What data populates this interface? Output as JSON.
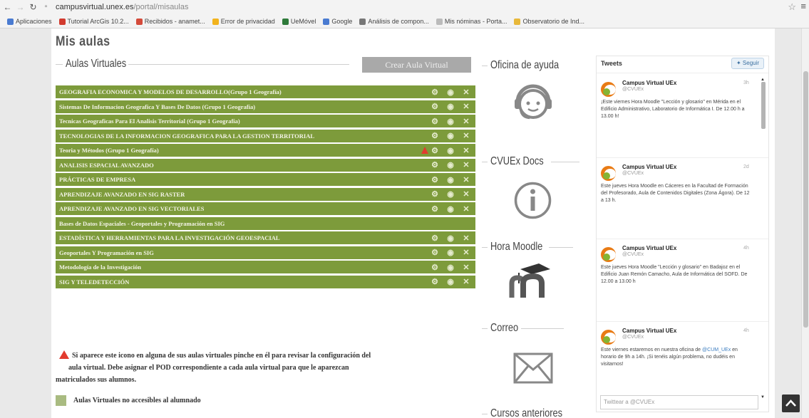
{
  "browser": {
    "url_host": "campusvirtual.unex.es",
    "url_path": "/portal/misaulas",
    "bookmarks": [
      {
        "label": "Aplicaciones",
        "color": "#4a7bd1"
      },
      {
        "label": "Tutorial ArcGis 10.2...",
        "color": "#d23b2f"
      },
      {
        "label": "Recibidos - anamet...",
        "color": "#d44a3a"
      },
      {
        "label": "Error de privacidad",
        "color": "#f2b31d"
      },
      {
        "label": "UeMóvel",
        "color": "#2e7a3a"
      },
      {
        "label": "Google",
        "color": "#4a7bd1"
      },
      {
        "label": "Análisis de compon...",
        "color": "#777777"
      },
      {
        "label": "Mis nóminas - Porta...",
        "color": "#bbbbbb"
      },
      {
        "label": "Observatorio de Ind...",
        "color": "#e8b83a"
      }
    ]
  },
  "main": {
    "heading": "Mis aulas",
    "aulas_title": "Aulas Virtuales",
    "crear_label": "Crear Aula Virtual",
    "courses": [
      {
        "name": "GEOGRAFIA ECONOMICA Y MODELOS DE DESARROLLO(Grupo 1 Geografía)",
        "actions": true,
        "warning": false
      },
      {
        "name": "Sistemas De Informacion Geografica Y Bases De Datos (Grupo 1 Geografía)",
        "actions": true,
        "warning": false
      },
      {
        "name": "Tecnicas Geograficas Para El Analisis Territorial (Grupo 1 Geografía)",
        "actions": true,
        "warning": false
      },
      {
        "name": "TECNOLOGIAS DE LA INFORMACION GEOGRAFICA PARA LA GESTION TERRITORIAL",
        "actions": true,
        "warning": false
      },
      {
        "name": "Teoria y Métodos (Grupo 1 Geografía)",
        "actions": true,
        "warning": true
      },
      {
        "name": "ANALISIS ESPACIAL AVANZADO",
        "actions": true,
        "warning": false
      },
      {
        "name": "PRÁCTICAS DE EMPRESA",
        "actions": true,
        "warning": false
      },
      {
        "name": "APRENDIZAJE AVANZADO EN SIG RASTER",
        "actions": true,
        "warning": false
      },
      {
        "name": "APRENDIZAJE AVANZADO EN SIG VECTORIALES",
        "actions": true,
        "warning": false
      },
      {
        "name": "Bases de Datos Espaciales - Geoportales y Programación en SIG",
        "actions": false,
        "warning": false
      },
      {
        "name": "ESTADÍSTICA Y HERRAMIENTAS PARA LA INVESTIGACIÓN GEOESPACIAL",
        "actions": true,
        "warning": false
      },
      {
        "name": "Geoportales Y Programación en SIG",
        "actions": true,
        "warning": false
      },
      {
        "name": "Metodología de la Investigación",
        "actions": true,
        "warning": false
      },
      {
        "name": "SIG Y TELEDETECCIÓN",
        "actions": true,
        "warning": false
      }
    ],
    "notice_l1": "Si aparece este icono en alguna de sus aulas virtuales pinche en él para revisar la configuración del",
    "notice_l2": "aula virtual. Debe asignar el POD correspondiente a cada aula virtual para que le aparezcan",
    "notice_l3": "matriculados sus alumnos.",
    "legend_label": "Aulas Virtuales no accesibles al alumnado"
  },
  "sidebar": {
    "ayuda": "Oficina de ayuda",
    "docs": "CVUEx Docs",
    "moodle": "Hora Moodle",
    "correo": "Correo",
    "cursos": "Cursos anteriores"
  },
  "tweets": {
    "header": "Tweets",
    "follow": "Seguir",
    "compose_placeholder": "Twittear a @CVUEx",
    "items": [
      {
        "author": "Campus Virtual UEx",
        "handle": "@CVUEx",
        "date": "3h",
        "body": "¡Este viernes Hora Moodle \"Lección y glosario\" en Mérida en el Edificio Administrativo, Laboratorio de Informática I. De 12.00 h a 13.00 h!"
      },
      {
        "author": "Campus Virtual UEx",
        "handle": "@CVUEx",
        "date": "2d",
        "body": "Este jueves Hora Moodle en Cáceres en la Facultad de Formación del Profesorado, Aula de Contenidos Digitales (Zona Ágora). De 12 a 13 h."
      },
      {
        "author": "Campus Virtual UEx",
        "handle": "@CVUEx",
        "date": "4h",
        "body": "Este jueves Hora Moodle \"Lección y glosario\" en Badajoz en el Edificio Juan Remón Camacho, Aula de Informática del SOFD. De 12.00 a 13.00 h"
      },
      {
        "author": "Campus Virtual UEx",
        "handle": "@CVUEx",
        "date": "4h",
        "body_pre": "Este viernes estaremos en nuestra oficina de ",
        "body_link": "@CUM_UEx",
        "body_post": " en horario de 9h a 14h. ¡Si tenéis algún problema, no dudéis en visitarnos!"
      }
    ]
  },
  "colors": {
    "course_bar": "#7d9b3b",
    "legend_swatch": "#a9bb81",
    "warning": "#e23b2f"
  }
}
